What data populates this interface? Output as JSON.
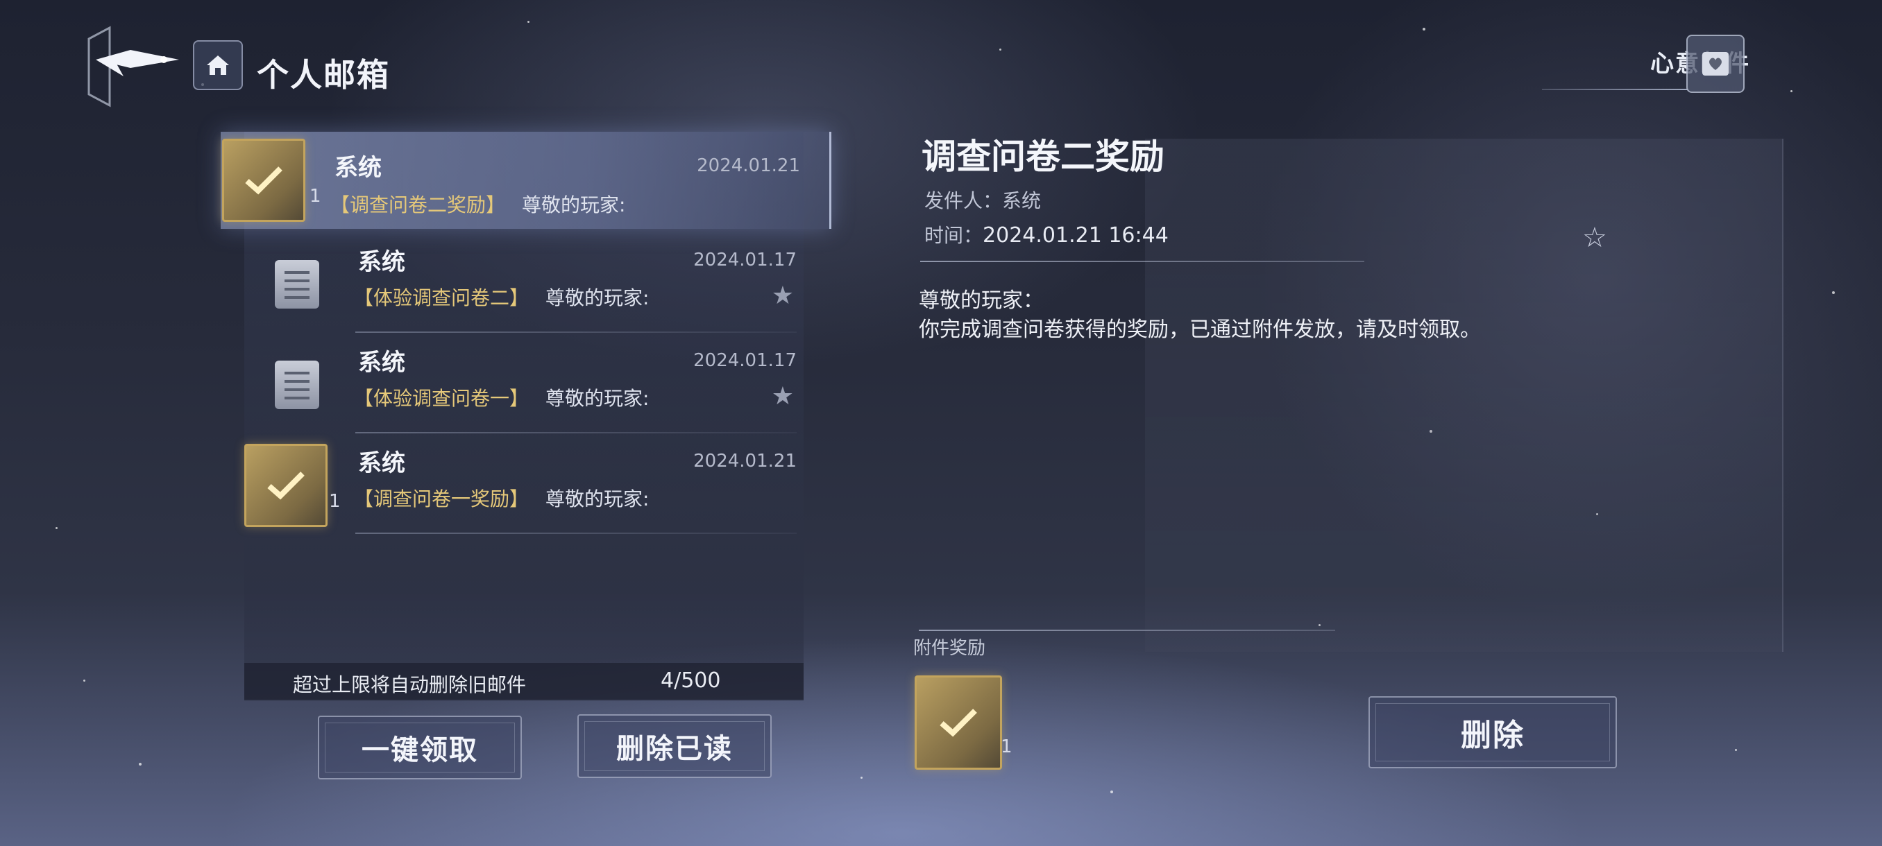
{
  "header": {
    "title": "个人邮箱",
    "gift_mail_label": "心意邮件"
  },
  "mail_list": {
    "items": [
      {
        "sender": "系统",
        "date": "2024.01.21",
        "subject": "【调查问卷二奖励】",
        "preview": "尊敬的玩家:",
        "icon": "reward-box-icon",
        "qty": "1",
        "selected": true
      },
      {
        "sender": "系统",
        "date": "2024.01.17",
        "subject": "【体验调查问卷二】",
        "preview": "尊敬的玩家:",
        "icon": "document-icon",
        "starred_icon": "star-icon"
      },
      {
        "sender": "系统",
        "date": "2024.01.17",
        "subject": "【体验调查问卷一】",
        "preview": "尊敬的玩家:",
        "icon": "document-icon",
        "starred_icon": "star-icon"
      },
      {
        "sender": "系统",
        "date": "2024.01.21",
        "subject": "【调查问卷一奖励】",
        "preview": "尊敬的玩家:",
        "icon": "reward-box-icon",
        "qty": "1"
      }
    ],
    "limit_notice": "超过上限将自动删除旧邮件",
    "count": "4/500"
  },
  "actions": {
    "claim_all": "一键领取",
    "delete_read": "删除已读",
    "delete": "删除"
  },
  "detail": {
    "title": "调查问卷二奖励",
    "sender_line": "发件人：系统",
    "time_label": "时间：",
    "time_value": "2024.01.21 16:44",
    "greeting": "尊敬的玩家：",
    "body": "你完成调查问卷获得的奖励，已通过附件发放，请及时领取。",
    "attachment_label": "附件奖励",
    "attachment_qty": "1"
  },
  "colors": {
    "subject_gold": "#e5c879",
    "reward_gold": "#c3a45d"
  }
}
